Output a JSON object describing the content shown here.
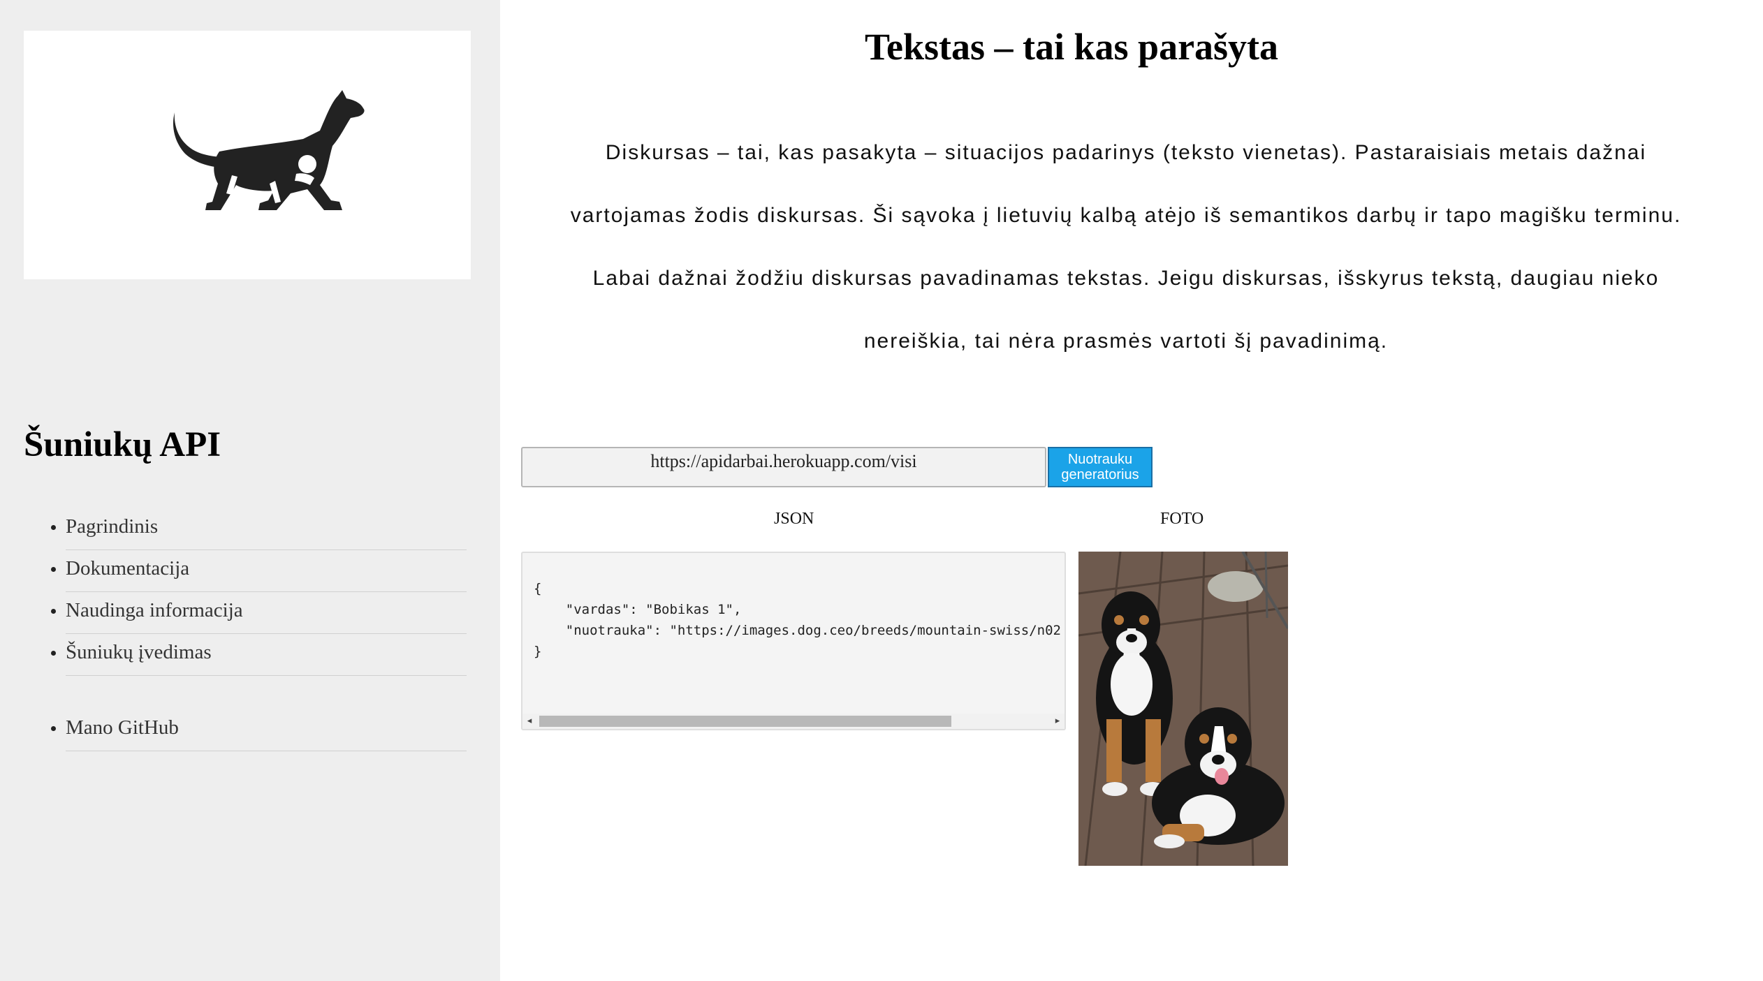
{
  "sidebar": {
    "logo_icon": "dog-silhouette-icon",
    "title": "Šuniukų API",
    "nav_items": [
      {
        "label": "Pagrindinis"
      },
      {
        "label": "Dokumentacija"
      },
      {
        "label": "Naudinga informacija"
      },
      {
        "label": "Šuniukų įvedimas"
      },
      {
        "label": "Mano GitHub"
      }
    ]
  },
  "main": {
    "title": "Tekstas – tai kas parašyta",
    "intro_lines": [
      "Diskursas – tai, kas pasakyta – situacijos padarinys (teksto vienetas). Pastaraisiais metais dažnai",
      "vartojamas žodis diskursas. Ši sąvoka į lietuvių kalbą atėjo iš semantikos darbų ir tapo magišku terminu.",
      "Labai dažnai žodžiu diskursas pavadinamas tekstas. Jeigu diskursas, išskyrus tekstą, daugiau nieko",
      "nereiškia, tai nėra prasmės vartoti šį pavadinimą."
    ],
    "url_input_value": "https://apidarbai.herokuapp.com/visi",
    "button_label_line1": "Nuotrauku",
    "button_label_line2": "generatorius",
    "json_label": "JSON",
    "foto_label": "FOTO",
    "json_lines": [
      "{",
      "    \"vardas\": \"Bobikas 1\",",
      "    \"nuotrauka\": \"https://images.dog.ceo/breeds/mountain-swiss/n02",
      "}"
    ],
    "scroll_left_icon": "◂",
    "scroll_right_icon": "▸"
  },
  "colors": {
    "sidebar_bg": "#eeeeee",
    "button_bg": "#1ba3e8",
    "json_bg": "#f4f4f4"
  }
}
